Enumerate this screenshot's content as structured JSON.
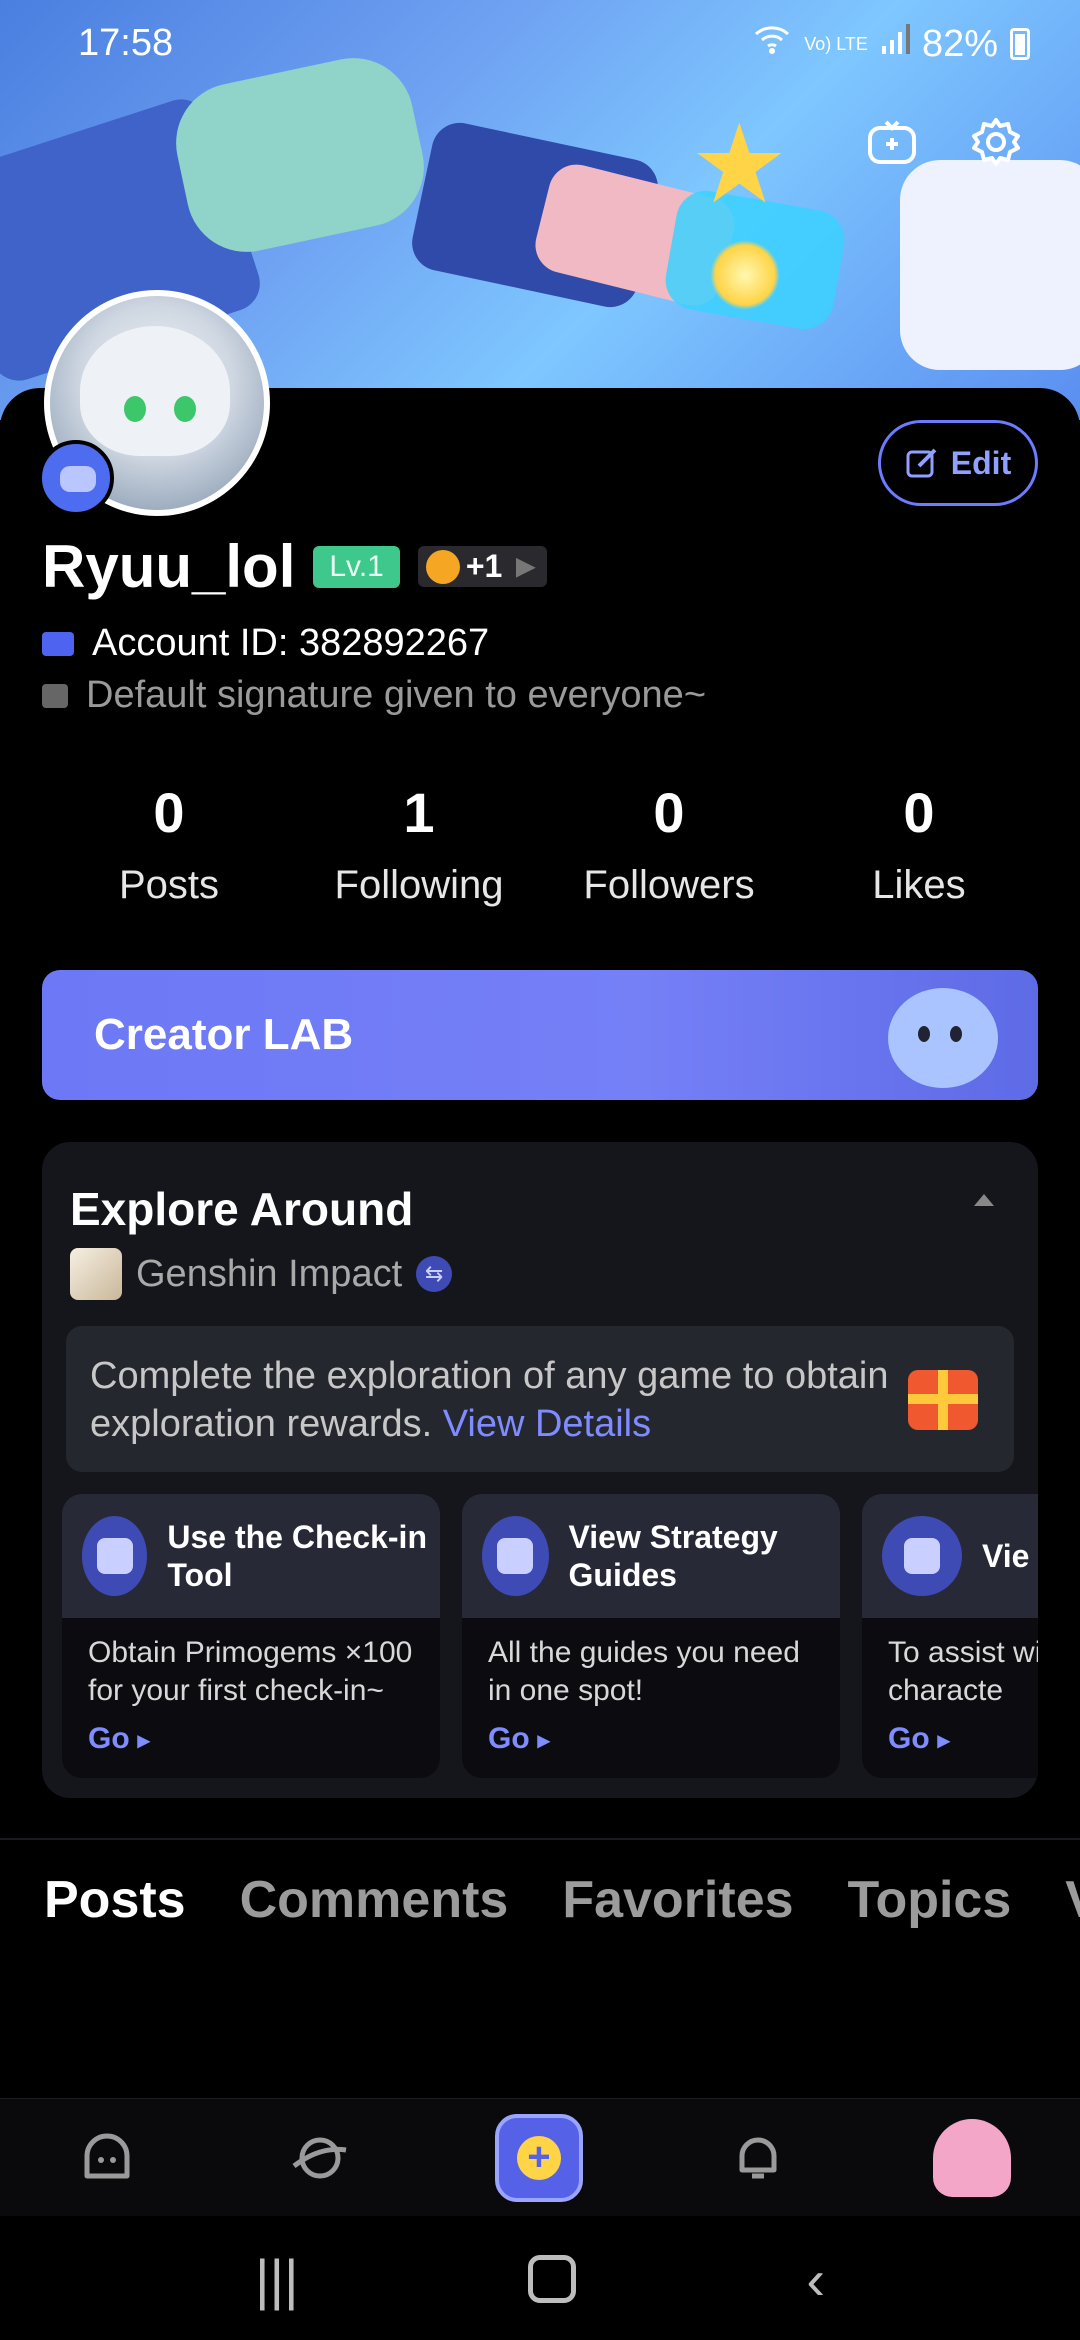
{
  "status_bar": {
    "time": "17:58",
    "network": "Vo) LTE",
    "battery": "82%"
  },
  "profile": {
    "username": "Ryuu_lol",
    "level": "Lv.1",
    "medal_extra": "+1",
    "account_id": "Account ID: 382892267",
    "signature": "Default signature given to everyone~",
    "edit_label": "Edit"
  },
  "stats": [
    {
      "value": "0",
      "label": "Posts"
    },
    {
      "value": "1",
      "label": "Following"
    },
    {
      "value": "0",
      "label": "Followers"
    },
    {
      "value": "0",
      "label": "Likes"
    }
  ],
  "creator_lab": {
    "label": "Creator LAB"
  },
  "explore": {
    "title": "Explore Around",
    "game": "Genshin Impact",
    "notice_text": "Complete the exploration of any game to obtain exploration rewards.",
    "notice_link": "View Details",
    "tools": [
      {
        "title": "Use the Check-in Tool",
        "desc": "Obtain Primogems ×100 for your first check-in~",
        "go": "Go"
      },
      {
        "title": "View Strategy Guides",
        "desc": "All the guides you need in one spot!",
        "go": "Go"
      },
      {
        "title": "Vie",
        "desc": "To assist wi and characte",
        "go": "Go"
      }
    ]
  },
  "tabs": [
    "Posts",
    "Comments",
    "Favorites",
    "Topics",
    "V"
  ],
  "colors": {
    "accent": "#5c6cf0",
    "level_badge": "#3fc88b",
    "link": "#7f8cff"
  }
}
